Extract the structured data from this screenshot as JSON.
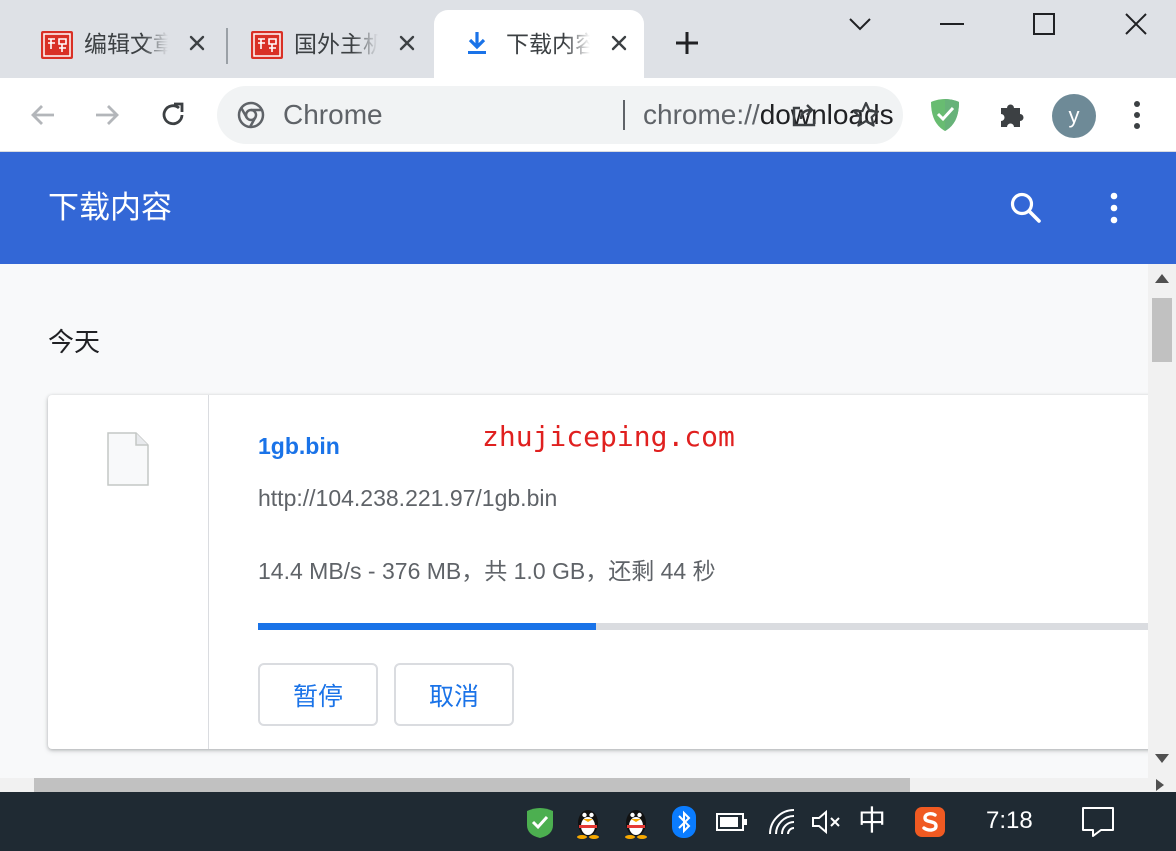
{
  "tabs": [
    {
      "title": "编辑文章",
      "active": false,
      "favicon": "seal-favicon"
    },
    {
      "title": "国外主机",
      "active": false,
      "favicon": "seal-favicon"
    },
    {
      "title": "下载内容",
      "active": true,
      "favicon": "download-icon"
    }
  ],
  "toolbar": {
    "chip_label": "Chrome",
    "url_scheme": "chrome://",
    "url_host": "downloads",
    "profile_initial": "y"
  },
  "downloads_page": {
    "title": "下载内容",
    "date_group": "今天",
    "items": [
      {
        "filename": "1gb.bin",
        "url": "http://104.238.221.97/1gb.bin",
        "status": "14.4 MB/s - 376 MB，共 1.0 GB，还剩 44 秒",
        "progress": 0.376,
        "pause_label": "暂停",
        "cancel_label": "取消"
      }
    ],
    "watermark": "zhujiceping.com"
  },
  "taskbar": {
    "ime_label": "中",
    "clock": "7:18"
  },
  "colors": {
    "header_blue": "#3367d6",
    "accent_blue": "#1a73e8",
    "watermark_red": "#e0201f",
    "taskbar": "#1f2a33"
  }
}
